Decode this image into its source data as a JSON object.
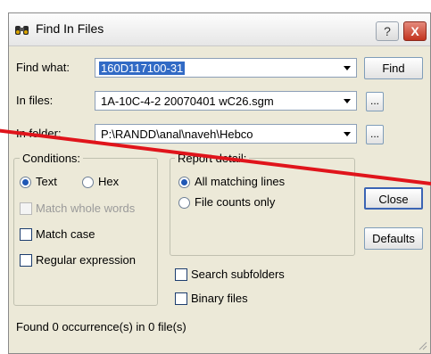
{
  "window": {
    "title": "Find In Files",
    "help_label": "?",
    "close_label": "X"
  },
  "form": {
    "find_what": {
      "label": "Find what:",
      "value": "160D117100-31"
    },
    "in_files": {
      "label": "In files:",
      "value": "1A-10C-4-2 20070401 wC26.sgm"
    },
    "in_folder": {
      "label": "In folder:",
      "value": "P:\\RANDD\\anal\\naveh\\Hebco"
    },
    "browse_label": "..."
  },
  "buttons": {
    "find": "Find",
    "close": "Close",
    "defaults": "Defaults"
  },
  "conditions": {
    "title": "Conditions:",
    "text_label": "Text",
    "hex_label": "Hex",
    "match_whole_words": "Match whole words",
    "match_case": "Match case",
    "regular_expression": "Regular expression"
  },
  "report": {
    "title": "Report detail:",
    "all_matching_lines": "All matching lines",
    "file_counts_only": "File counts only"
  },
  "options": {
    "search_subfolders": "Search subfolders",
    "binary_files": "Binary files"
  },
  "status": {
    "text": "Found 0 occurrence(s) in 0 file(s)"
  },
  "colors": {
    "annotation_line": "#e0141b",
    "selection": "#316ac5"
  }
}
